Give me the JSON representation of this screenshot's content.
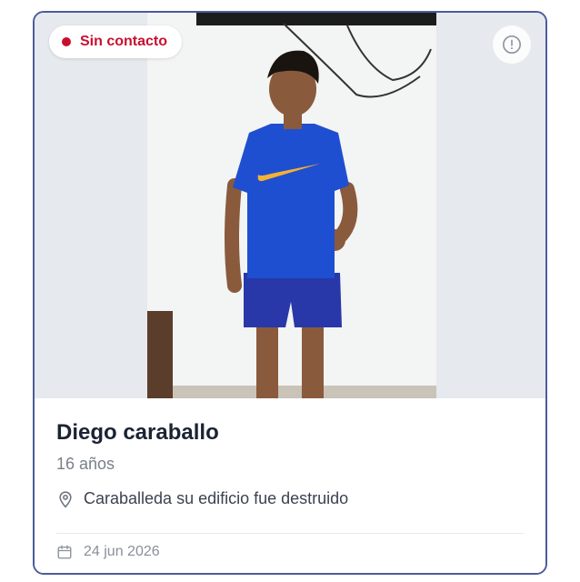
{
  "card": {
    "status": {
      "label": "Sin contacto",
      "color": "#c8102e"
    },
    "photo_icon": "person-photo",
    "info_icon": "alert-circle-icon",
    "name": "Diego caraballo",
    "age": "16 años",
    "location_icon": "map-pin-icon",
    "location": "Caraballeda su edificio fue destruido",
    "date_icon": "calendar-icon",
    "date": "24 jun 2026",
    "border_color": "#4a5c9c"
  }
}
